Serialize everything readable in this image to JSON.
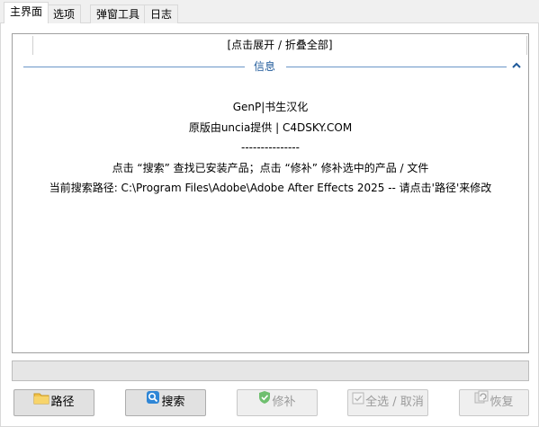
{
  "tabs": [
    {
      "label": "主界面",
      "active": true
    },
    {
      "label": "选项",
      "active": false
    },
    {
      "label": "弹窗工具",
      "active": false
    },
    {
      "label": "日志",
      "active": false
    }
  ],
  "main": {
    "expand_toggle": "[点击展开 / 折叠全部]",
    "group_title": "信息",
    "info_lines": [
      "GenP|书生汉化",
      "原版由uncia提供 | C4DSKY.COM",
      "---------------",
      "点击 “搜索” 查找已安装产品；点击 “修补” 修补选中的产品 / 文件",
      "当前搜索路径: C:\\Program Files\\Adobe\\Adobe After Effects 2025 -- 请点击'路径'来修改"
    ]
  },
  "buttons": {
    "path": {
      "label": "路径",
      "icon": "folder-icon",
      "enabled": true
    },
    "search": {
      "label": "搜索",
      "icon": "search-icon",
      "enabled": true
    },
    "patch": {
      "label": "修补",
      "icon": "shield-check-icon",
      "enabled": false
    },
    "select_all": {
      "label": "全选 / 取消",
      "icon": "checkbox-icon",
      "enabled": false
    },
    "restore": {
      "label": "恢复",
      "icon": "restore-icon",
      "enabled": false
    }
  },
  "colors": {
    "group_line": "#6a96c8",
    "group_title": "#1f5a9a",
    "folder": "#f2c24b",
    "search": "#2f86d6",
    "shield": "#6fbf6f"
  }
}
